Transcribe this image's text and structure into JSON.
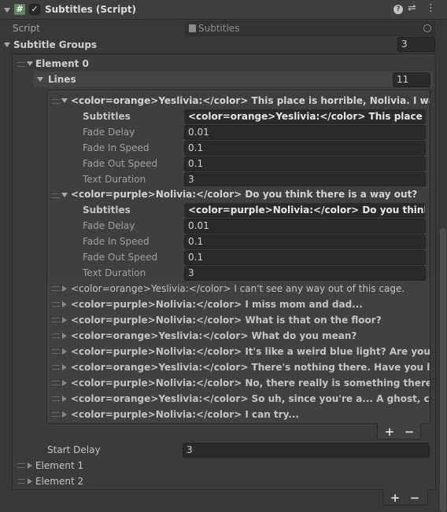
{
  "header": {
    "title": "Subtitles (Script)",
    "enabled": true
  },
  "script_row": {
    "label": "Script",
    "value": "Subtitles"
  },
  "subtitle_groups": {
    "label": "Subtitle Groups",
    "count": "3"
  },
  "element0": {
    "label": "Element 0",
    "lines": {
      "label": "Lines",
      "count": "11"
    },
    "expanded": [
      {
        "title": "<color=orange>Yeslivia:</color> This place is horrible, Nolivia. I want to leave.",
        "fields": [
          {
            "label": "Subtitles",
            "value": "<color=orange>Yeslivia:</color> This place is horrible, Nolivia. I want to leave."
          },
          {
            "label": "Fade Delay",
            "value": "0.01"
          },
          {
            "label": "Fade In Speed",
            "value": "0.1"
          },
          {
            "label": "Fade Out Speed",
            "value": "0.1"
          },
          {
            "label": "Text Duration",
            "value": "3"
          }
        ]
      },
      {
        "title": "<color=purple>Nolivia:</color> Do you think there is a way out?",
        "fields": [
          {
            "label": "Subtitles",
            "value": "<color=purple>Nolivia:</color> Do you think there is a way out?"
          },
          {
            "label": "Fade Delay",
            "value": "0.01"
          },
          {
            "label": "Fade In Speed",
            "value": "0.1"
          },
          {
            "label": "Fade Out Speed",
            "value": "0.1"
          },
          {
            "label": "Text Duration",
            "value": "3"
          }
        ]
      }
    ],
    "collapsed": [
      {
        "text": "<color=orange>Yeslivia:</color> I can't see any way out of this cage."
      },
      {
        "text": "<color=purple>Nolivia:</color> I miss mom and dad..."
      },
      {
        "text": "<color=purple>Nolivia:</color> What is that on the floor?"
      },
      {
        "text": "<color=orange>Yeslivia:</color> What do you mean?"
      },
      {
        "text": "<color=purple>Nolivia:</color> It's like a weird blue light? Are you sure you can't see it?"
      },
      {
        "text": "<color=orange>Yeslivia:</color> There's nothing there. Have you lost your mind?"
      },
      {
        "text": "<color=purple>Nolivia:</color> No, there really is something there. Maybe it's magic."
      },
      {
        "text": "<color=orange>Yeslivia:</color> So uh, since you're a... A ghost, could you maybe get us out?"
      },
      {
        "text": "<color=purple>Nolivia:</color> I can try..."
      }
    ],
    "plus": "+",
    "minus": "−",
    "start_delay": {
      "label": "Start Delay",
      "value": "3"
    }
  },
  "other_elements": [
    {
      "label": "Element 1"
    },
    {
      "label": "Element 2"
    }
  ],
  "bottom_buttons": {
    "plus": "+",
    "minus": "−"
  },
  "icons": {
    "script": "hash-icon",
    "help": "help-icon",
    "presets": "presets-icon",
    "menu": "kebab-menu-icon",
    "object": "script-asset-icon",
    "picker": "object-picker-icon"
  }
}
